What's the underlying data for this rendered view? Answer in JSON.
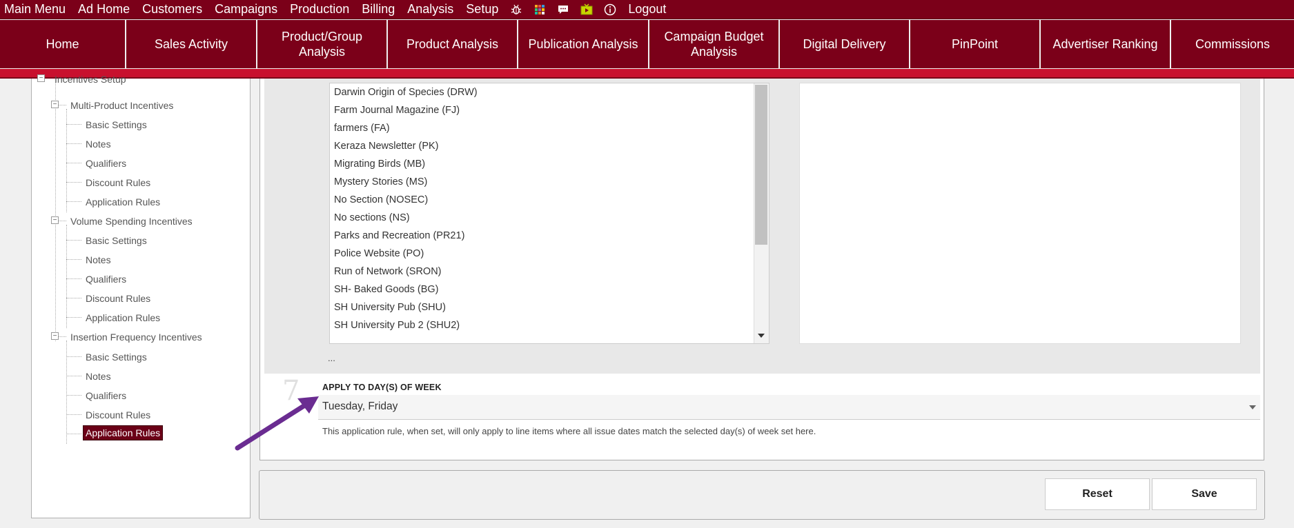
{
  "top_menu": [
    "Main Menu",
    "Ad Home",
    "Customers",
    "Campaigns",
    "Production",
    "Billing",
    "Analysis",
    "Setup"
  ],
  "top_icons": [
    "bug-icon",
    "apps-grid-icon",
    "chat-icon",
    "tv-icon",
    "info-icon"
  ],
  "logout_label": "Logout",
  "main_nav": [
    "Home",
    "Sales Activity",
    "Product/Group Analysis",
    "Product Analysis",
    "Publication Analysis",
    "Campaign Budget Analysis",
    "Digital Delivery",
    "PinPoint",
    "Advertiser Ranking",
    "Commissions"
  ],
  "tree": {
    "root": "Incentives Setup",
    "groups": [
      {
        "label": "Multi-Product Incentives",
        "items": [
          "Basic Settings",
          "Notes",
          "Qualifiers",
          "Discount Rules",
          "Application Rules"
        ]
      },
      {
        "label": "Volume Spending Incentives",
        "items": [
          "Basic Settings",
          "Notes",
          "Qualifiers",
          "Discount Rules",
          "Application Rules"
        ]
      },
      {
        "label": "Insertion Frequency Incentives",
        "items": [
          "Basic Settings",
          "Notes",
          "Qualifiers",
          "Discount Rules",
          "Application Rules"
        ]
      }
    ],
    "selected": "Application Rules"
  },
  "product_list": [
    "Darwin Origin of Species (DRW)",
    "Farm Journal Magazine (FJ)",
    "farmers (FA)",
    "Keraza Newsletter (PK)",
    "Migrating Birds (MB)",
    "Mystery Stories (MS)",
    "No Section (NOSEC)",
    "No sections (NS)",
    "Parks and Recreation (PR21)",
    "Police Website (PO)",
    "Run of Network (SRON)",
    "SH- Baked Goods (BG)",
    "SH University Pub (SHU)",
    "SH University Pub 2 (SHU2)"
  ],
  "list_ellipsis": "...",
  "step": {
    "number": "7",
    "label": "APPLY TO DAY(S) OF WEEK",
    "value": "Tuesday, Friday",
    "help": "This application rule, when set, will only apply to line items where all issue dates match the selected day(s) of week set here."
  },
  "buttons": {
    "reset": "Reset",
    "save": "Save"
  },
  "colors": {
    "brand": "#7b0019",
    "accent_red": "#c8102e",
    "arrow": "#6a2c91",
    "selected": "#6b0017"
  }
}
